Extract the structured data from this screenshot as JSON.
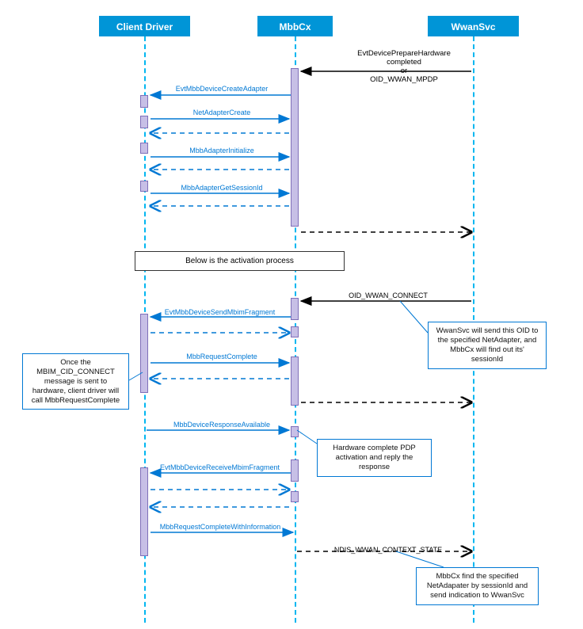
{
  "actors": {
    "client": "Client Driver",
    "mbbcx": "MbbCx",
    "wwansvc": "WwanSvc"
  },
  "top_note": {
    "line1": "EvtDevicePrepareHardware completed",
    "line2": "or",
    "line3": "OID_WWAN_MPDP"
  },
  "messages": {
    "m1": "EvtMbbDeviceCreateAdapter",
    "m2": "NetAdapterCreate",
    "m3": "MbbAdapterInitialize",
    "m4": "MbbAdapterGetSessionId",
    "m5": "OID_WWAN_CONNECT",
    "m6": "EvtMbbDeviceSendMbimFragment",
    "m7": "MbbRequestComplete",
    "m8": "MbbDeviceResponseAvailable",
    "m9": "EvtMbbDeviceReceiveMbimFragment",
    "m10": "MbbRequestCompleteWithInformation",
    "m11": "NDIS_WWAN_CONTEXT_STATE"
  },
  "notes": {
    "activation_divider": "Below is the activation process",
    "callout_wwansvc": "WwanSvc will send this OID to the specified NetAdapter, and MbbCx will find out its' sessionId",
    "callout_hardware": "Hardware complete PDP activation and reply the response",
    "callout_request": "Once the MBIM_CID_CONNECT message is sent to hardware, client driver will call MbbRequestComplete",
    "callout_ndis": "MbbCx find the specified NetAdapater by sessionId and send indication to WwanSvc"
  }
}
